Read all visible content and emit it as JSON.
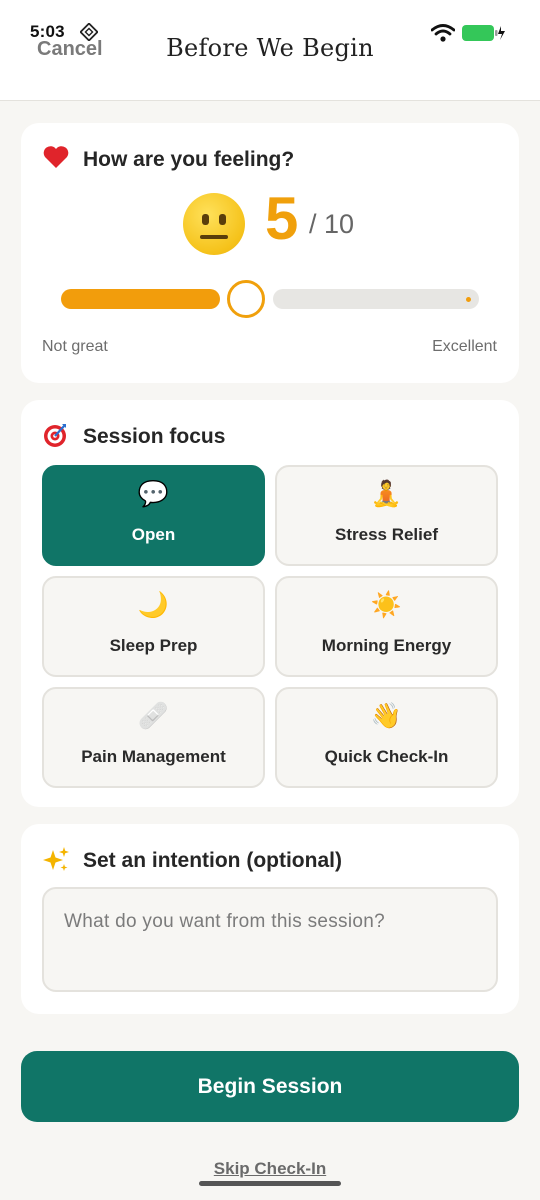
{
  "status_bar": {
    "time": "5:03"
  },
  "header": {
    "cancel_label": "Cancel",
    "title": "Before We Begin"
  },
  "mood": {
    "title": "How are you feeling?",
    "icon": "heart-icon",
    "value": "5",
    "max_label": "/ 10",
    "level_fraction": 0.44,
    "min_label": "Not great",
    "max_scale_label": "Excellent",
    "accent_color": "#f0a00c"
  },
  "focus": {
    "title": "Session focus",
    "icon": "target-icon",
    "options": [
      {
        "label": "Open",
        "icon": "speech-bubble-icon",
        "glyph": "💬",
        "selected": true
      },
      {
        "label": "Stress Relief",
        "icon": "meditation-icon",
        "glyph": "🧘",
        "selected": false
      },
      {
        "label": "Sleep Prep",
        "icon": "moon-icon",
        "glyph": "🌙",
        "selected": false
      },
      {
        "label": "Morning Energy",
        "icon": "sun-icon",
        "glyph": "☀️",
        "selected": false
      },
      {
        "label": "Pain Management",
        "icon": "bandage-icon",
        "glyph": "🩹",
        "selected": false
      },
      {
        "label": "Quick Check-In",
        "icon": "waving-hand-icon",
        "glyph": "👋",
        "selected": false
      }
    ],
    "selected_color": "#107567"
  },
  "intention": {
    "title": "Set an intention (optional)",
    "icon": "sparkles-icon",
    "placeholder": "What do you want from this session?",
    "value": ""
  },
  "actions": {
    "begin_label": "Begin Session",
    "skip_label": "Skip Check-In",
    "primary_color": "#107567"
  }
}
